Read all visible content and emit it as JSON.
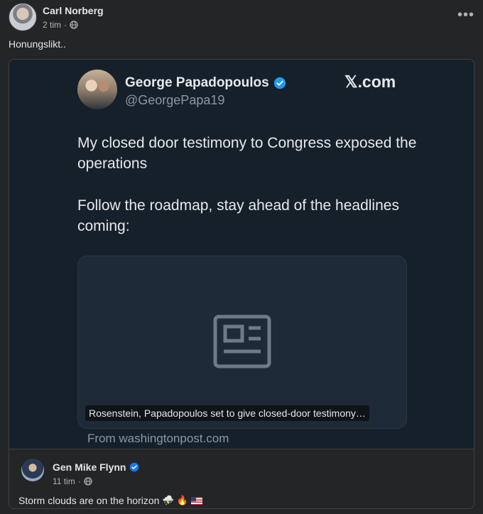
{
  "post": {
    "author": "Carl Norberg",
    "time": "2 tim",
    "separator": "·",
    "text": "Honungslikt..",
    "more_icon": "more-horizontal-icon"
  },
  "tweet": {
    "name": "George Papadopoulos",
    "handle": "@GeorgePapa19",
    "site": "𝕏.com",
    "paragraph1": "My closed door testimony to Congress exposed the operations",
    "paragraph2": "Follow the roadmap, stay ahead of the headlines coming:",
    "card_title": "Rosenstein, Papadopoulos set to give closed-door testimony…",
    "from": "From washingtonpost.com"
  },
  "comment": {
    "author": "Gen Mike Flynn",
    "time": "11 tim",
    "separator": "·",
    "text": "Storm clouds are on the horizon",
    "emoji_storm": "⛈️",
    "emoji_fire": "🔥"
  },
  "colors": {
    "background": "#242526",
    "tweet_bg": "#15202b",
    "verified_blue": "#1d9bf0"
  }
}
